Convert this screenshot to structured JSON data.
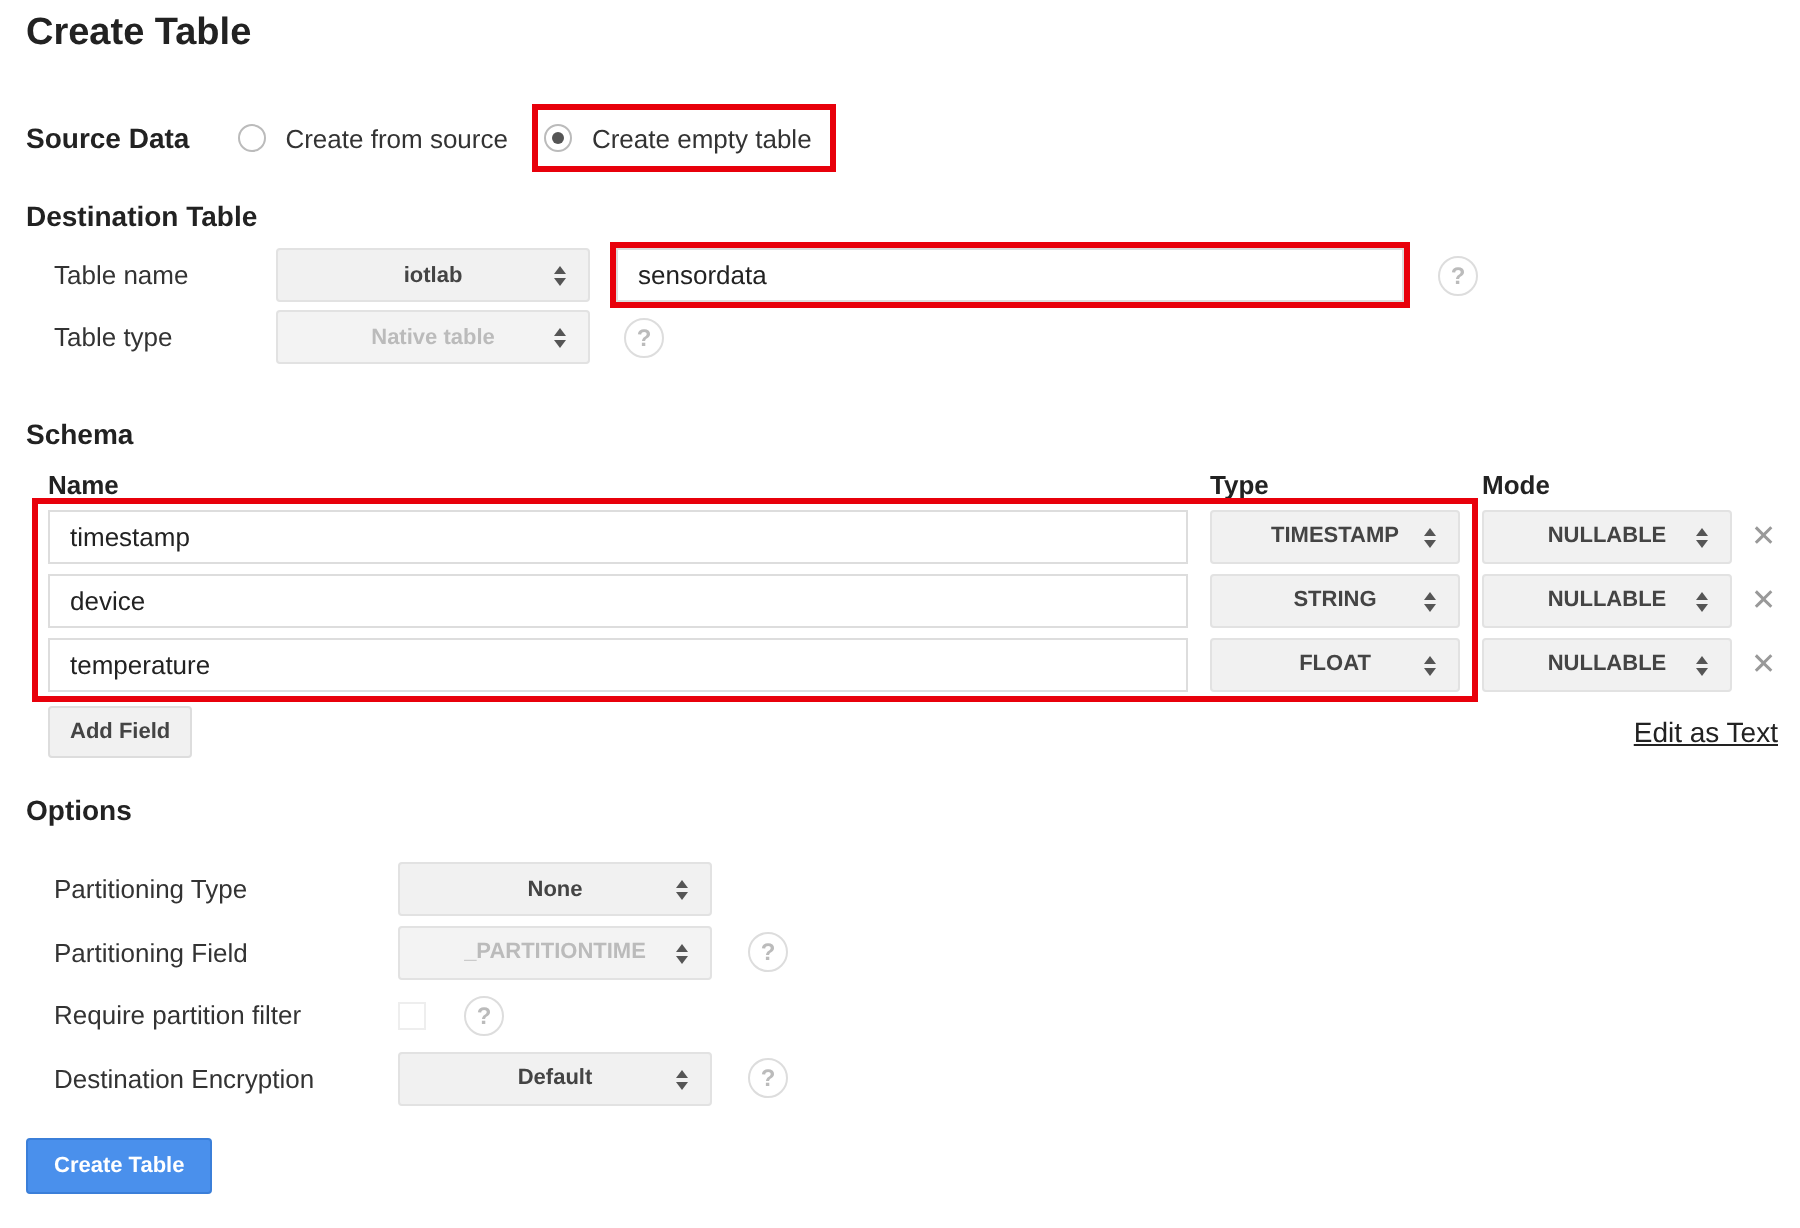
{
  "title": "Create Table",
  "source": {
    "label": "Source Data",
    "options": [
      {
        "label": "Create from source",
        "selected": false,
        "highlighted": false
      },
      {
        "label": "Create empty table",
        "selected": true,
        "highlighted": true
      }
    ]
  },
  "destination": {
    "heading": "Destination Table",
    "rows": [
      {
        "label": "Table name",
        "select": {
          "value": "iotlab",
          "disabled": false
        },
        "input": {
          "value": "sensordata",
          "highlighted": true
        },
        "help": "?"
      },
      {
        "label": "Table type",
        "select": {
          "value": "Native table",
          "disabled": true
        },
        "help": "?"
      }
    ]
  },
  "schema": {
    "heading": "Schema",
    "columns": [
      "Name",
      "Type",
      "Mode"
    ],
    "highlighted": true,
    "fields": [
      {
        "name": "timestamp",
        "type": "TIMESTAMP",
        "mode": "NULLABLE",
        "remove": "✕"
      },
      {
        "name": "device",
        "type": "STRING",
        "mode": "NULLABLE",
        "remove": "✕"
      },
      {
        "name": "temperature",
        "type": "FLOAT",
        "mode": "NULLABLE",
        "remove": "✕"
      }
    ],
    "add_button": "Add Field",
    "edit_link": "Edit as Text"
  },
  "options": {
    "heading": "Options",
    "rows": [
      {
        "kind": "select",
        "label": "Partitioning Type",
        "value": "None",
        "disabled": false
      },
      {
        "kind": "select",
        "label": "Partitioning Field",
        "value": "_PARTITIONTIME",
        "disabled": true,
        "help": "?"
      },
      {
        "kind": "checkbox",
        "label": "Require partition filter",
        "checked": false,
        "disabled": true,
        "help": "?"
      },
      {
        "kind": "select",
        "label": "Destination Encryption",
        "value": "Default",
        "disabled": false,
        "help": "?"
      }
    ]
  },
  "submit": "Create Table"
}
